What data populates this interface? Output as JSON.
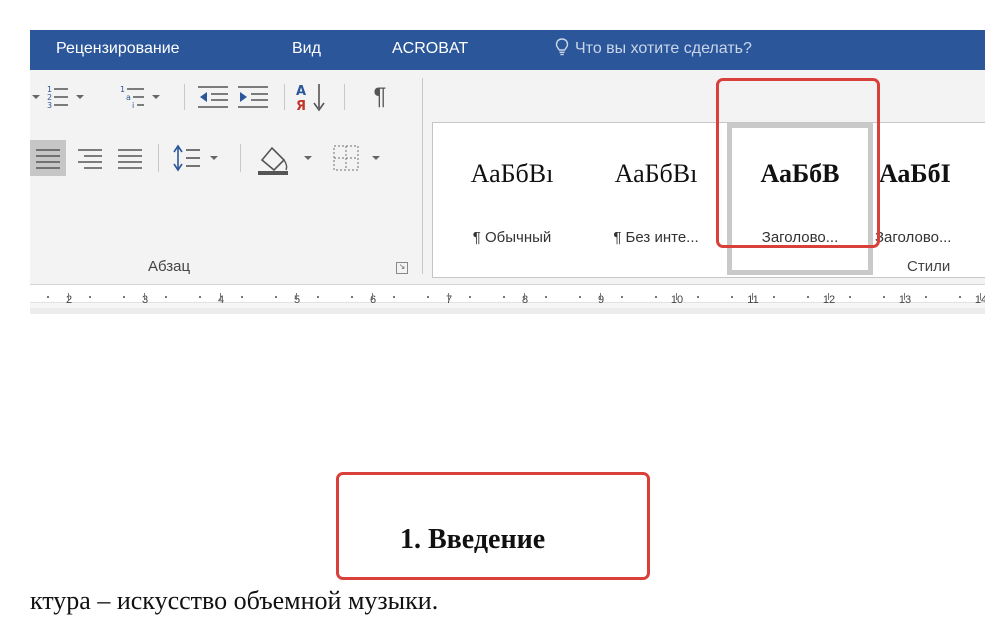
{
  "ribbon_tabs": [
    {
      "label": "Рецензирование"
    },
    {
      "label": "Вид"
    },
    {
      "label": "ACROBAT"
    }
  ],
  "tell_me": {
    "label": "Что вы хотите сделать?",
    "icon": "lightbulb-icon"
  },
  "paragraph_group": {
    "label": "Абзац",
    "tools_row1": [
      "numbering-icon",
      "multilevel-list-icon",
      "decrease-indent-icon",
      "increase-indent-icon",
      "sort-icon",
      "pilcrow-icon"
    ],
    "tools_row2": [
      "align-left-icon",
      "align-center-icon",
      "align-right-icon",
      "justify-icon",
      "line-spacing-icon",
      "shading-icon",
      "borders-icon"
    ],
    "sort_glyph": "А↓",
    "pilcrow_glyph": "¶"
  },
  "styles_group": {
    "label": "Стили",
    "items": [
      {
        "sample": "АаБбВı",
        "name": "¶ Обычный"
      },
      {
        "sample": "АаБбВı",
        "name": "¶ Без инте..."
      },
      {
        "sample": "АаБбВ",
        "name": "Заголово...",
        "selected": true
      },
      {
        "sample": "АаБбI",
        "name": "Заголово..."
      }
    ]
  },
  "ruler": {
    "ticks": [
      "2",
      "3",
      "4",
      "5",
      "6",
      "7",
      "8",
      "9",
      "10",
      "11",
      "12",
      "13",
      "14"
    ]
  },
  "document": {
    "heading": "1. Введение",
    "body_fragment": "ктура – искусство объемной музыки."
  },
  "colors": {
    "ribbon_blue": "#2b579a",
    "highlight_red": "#d9403a"
  }
}
